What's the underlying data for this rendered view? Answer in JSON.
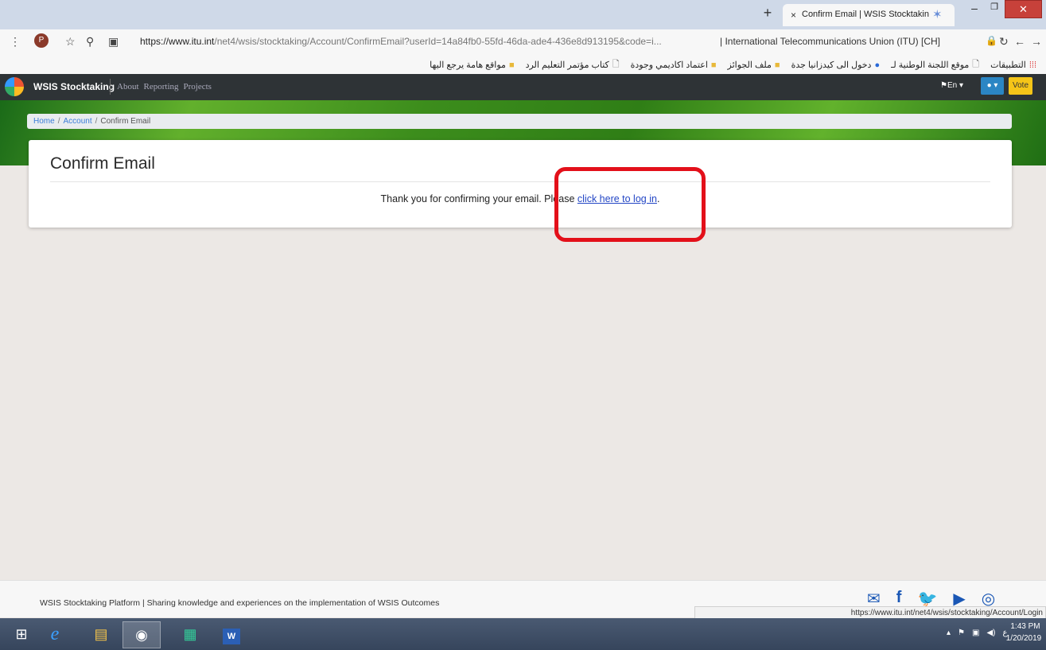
{
  "browser": {
    "tab_title": "Confirm Email | WSIS Stocktaking",
    "new_tab_glyph": "+",
    "tab_close_glyph": "×",
    "url_host": "https://www.itu.int",
    "url_path": "/net4/wsis/stocktaking/Account/ConfirmEmail?userId=14a84fb0-55fd-46da-ade4-436e8d913195&code=i...",
    "site_identity": "| International Telecommunications Union (ITU) [CH]",
    "avatar_letter": "P",
    "window_controls": {
      "minimize": "–",
      "maximize": "❐",
      "close": "✕"
    }
  },
  "bookmarks": [
    {
      "label": "التطبيقات",
      "icon": "apps-icon"
    },
    {
      "label": "موقع اللجنة الوطنية لـ",
      "icon": "page-icon"
    },
    {
      "label": "دخول الى كيدزانيا جدة",
      "icon": "globe-icon"
    },
    {
      "label": "ملف الجوائز",
      "icon": "folder-icon"
    },
    {
      "label": "اعتماد اكاديمي وجودة",
      "icon": "folder-icon"
    },
    {
      "label": "كتاب مؤتمر التعليم الرد",
      "icon": "page-icon"
    },
    {
      "label": "مواقع هامة يرجع اليها",
      "icon": "folder-icon"
    }
  ],
  "site_nav": {
    "brand": "WSIS Stocktaking",
    "links": [
      "About",
      "Reporting",
      "Projects"
    ],
    "language": "En",
    "vote": "Vote"
  },
  "breadcrumb": {
    "home": "Home",
    "account": "Account",
    "current": "Confirm Email",
    "separator": "/"
  },
  "card": {
    "title": "Confirm Email",
    "message_before": "Thank you for confirming your email. Please ",
    "link_text": "click here to log in",
    "message_after": "."
  },
  "footer": {
    "platform": "WSIS Stocktaking Platform",
    "tagline": "Sharing knowledge and experiences on the implementation of WSIS Outcomes",
    "divider": "|"
  },
  "status_bar_url": "https://www.itu.int/net4/wsis/stocktaking/Account/Login",
  "taskbar": {
    "time": "1:43 PM",
    "date": "1/20/2019",
    "tray_lang": "ع"
  },
  "colors": {
    "annotation_red": "#e3101a",
    "link_blue": "#2346c5",
    "navbar_dark": "#2e3336",
    "vote_yellow": "#f5c518"
  }
}
